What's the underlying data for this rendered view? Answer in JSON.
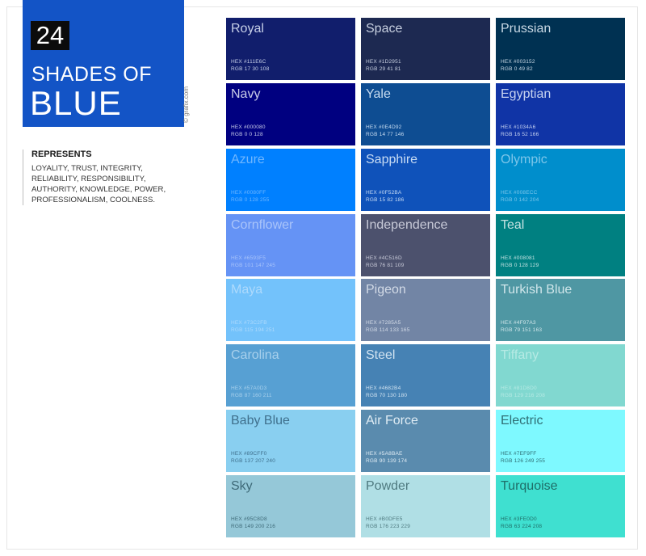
{
  "header": {
    "count": "24",
    "title_line1": "SHADES OF",
    "title_line2": "BLUE",
    "credit": "© grafix.com"
  },
  "represents": {
    "heading": "REPRESENTS",
    "text": "LOYALITY, TRUST, INTEGRITY, RELIABILITY, RESPONSIBILITY, AUTHORITY, KNOWLEDGE, POWER, PROFESSIONALISM, COOLNESS."
  },
  "swatches": [
    {
      "name": "Royal",
      "hex_label": "HEX #111E6C",
      "rgb_label": "RGB 17 30 108",
      "color": "#111E6C",
      "text_color": "#c8d0e8"
    },
    {
      "name": "Space",
      "hex_label": "HEX #1D2951",
      "rgb_label": "RGB 29 41 81",
      "color": "#1D2951",
      "text_color": "#c8d0e0"
    },
    {
      "name": "Prussian",
      "hex_label": "HEX #003152",
      "rgb_label": "RGB 0 49 82",
      "color": "#003152",
      "text_color": "#c8d8e4"
    },
    {
      "name": "Navy",
      "hex_label": "HEX #000080",
      "rgb_label": "RGB 0 0 128",
      "color": "#000080",
      "text_color": "#c8cce8"
    },
    {
      "name": "Yale",
      "hex_label": "HEX #0E4D92",
      "rgb_label": "RGB 14 77 146",
      "color": "#0E4D92",
      "text_color": "#c8dcf0"
    },
    {
      "name": "Egyptian",
      "hex_label": "HEX #1034A6",
      "rgb_label": "RGB 16 52 166",
      "color": "#1034A6",
      "text_color": "#c8d4f0"
    },
    {
      "name": "Azure",
      "hex_label": "HEX #0080FF",
      "rgb_label": "RGB 0 128 255",
      "color": "#0080FF",
      "text_color": "#6fb6ff"
    },
    {
      "name": "Sapphire",
      "hex_label": "HEX #0F52BA",
      "rgb_label": "RGB 15 82 186",
      "color": "#0F52BA",
      "text_color": "#c8dcf4"
    },
    {
      "name": "Olympic",
      "hex_label": "HEX #008ECC",
      "rgb_label": "RGB 0 142 204",
      "color": "#008ECC",
      "text_color": "#7cc6ea"
    },
    {
      "name": "Cornflower",
      "hex_label": "HEX #6593F5",
      "rgb_label": "RGB 101 147 245",
      "color": "#6593F5",
      "text_color": "#a9c4fa"
    },
    {
      "name": "Independence",
      "hex_label": "HEX #4C516D",
      "rgb_label": "RGB 76 81 109",
      "color": "#4C516D",
      "text_color": "#c8cad8"
    },
    {
      "name": "Teal",
      "hex_label": "HEX #008081",
      "rgb_label": "RGB 0 128 129",
      "color": "#008081",
      "text_color": "#c4e2e2"
    },
    {
      "name": "Maya",
      "hex_label": "HEX #73C2FB",
      "rgb_label": "RGB 115 194 251",
      "color": "#73C2FB",
      "text_color": "#aedafc"
    },
    {
      "name": "Pigeon",
      "hex_label": "HEX #7285A5",
      "rgb_label": "RGB 114 133 165",
      "color": "#7285A5",
      "text_color": "#d2dae6"
    },
    {
      "name": "Turkish Blue",
      "hex_label": "HEX #4F97A3",
      "rgb_label": "RGB 79 151 163",
      "color": "#4F97A3",
      "text_color": "#d0e6ea"
    },
    {
      "name": "Carolina",
      "hex_label": "HEX #57A0D3",
      "rgb_label": "RGB 87 160 211",
      "color": "#57A0D3",
      "text_color": "#a8d0ec"
    },
    {
      "name": "Steel",
      "hex_label": "HEX #4682B4",
      "rgb_label": "RGB 70 130 180",
      "color": "#4682B4",
      "text_color": "#d0e2f0"
    },
    {
      "name": "Tiffany",
      "hex_label": "HEX #81D8D0",
      "rgb_label": "RGB 129 216 208",
      "color": "#81D8D0",
      "text_color": "#b6eae4"
    },
    {
      "name": "Baby Blue",
      "hex_label": "HEX #89CFF0",
      "rgb_label": "RGB 137 207 240",
      "color": "#89CFF0",
      "text_color": "#3f6f8c"
    },
    {
      "name": "Air Force",
      "hex_label": "HEX #5A8BAE",
      "rgb_label": "RGB 90 139 174",
      "color": "#5A8BAE",
      "text_color": "#e0ecf4"
    },
    {
      "name": "Electric",
      "hex_label": "HEX #7EF9FF",
      "rgb_label": "RGB 126 249 255",
      "color": "#7EF9FF",
      "text_color": "#2f6e74"
    },
    {
      "name": "Sky",
      "hex_label": "HEX #95C8D8",
      "rgb_label": "RGB 149 200 216",
      "color": "#95C8D8",
      "text_color": "#3e6a78"
    },
    {
      "name": "Powder",
      "hex_label": "HEX #B0DFE5",
      "rgb_label": "RGB 176 223 229",
      "color": "#B0DFE5",
      "text_color": "#4f7a80"
    },
    {
      "name": "Turquoise",
      "hex_label": "HEX #3FE0D0",
      "rgb_label": "RGB 63 224 208",
      "color": "#3FE0D0",
      "text_color": "#1f6e68"
    }
  ]
}
